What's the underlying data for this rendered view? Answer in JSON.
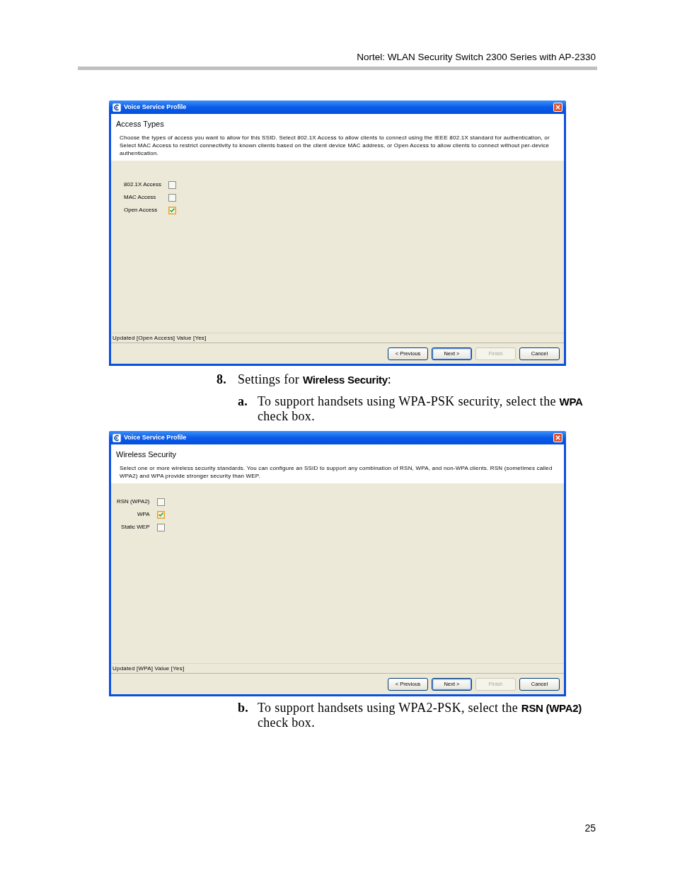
{
  "page_header": {
    "title": "Nortel: WLAN Security Switch 2300 Series with AP-2330"
  },
  "blocks": [
    {
      "kind": "dialog",
      "window_title": "Voice Service Profile",
      "heading": "Access Types",
      "description": "Choose the types of access you want to allow for this SSID. Select 802.1X Access to allow clients to connect using the IEEE 802.1X standard for authentication, or Select MAC Access to restrict connectivity to known clients based on the client device MAC address, or Open Access to allow clients to connect without per-device authentication.",
      "labels_right_aligned": false,
      "options": [
        {
          "label": "802.1X Access",
          "checked": false,
          "highlighted": false
        },
        {
          "label": "MAC Access",
          "checked": false,
          "highlighted": false
        },
        {
          "label": "Open Access",
          "checked": true,
          "highlighted": true
        }
      ],
      "status_text": "Updated [Open Access] Value [Yes]",
      "buttons": [
        {
          "label": "< Previous",
          "disabled": false,
          "default": false
        },
        {
          "label": "Next >",
          "disabled": false,
          "default": true
        },
        {
          "label": "Finish",
          "disabled": true,
          "default": false
        },
        {
          "label": "Cancel",
          "disabled": false,
          "default": false
        }
      ]
    },
    {
      "kind": "step",
      "number": "8.",
      "text": "Settings for **Wireless Security**:"
    },
    {
      "kind": "substep",
      "number": "a.",
      "text": "To support handsets using WPA-PSK security, select the **WPA** check box."
    },
    {
      "kind": "dialog",
      "window_title": "Voice Service Profile",
      "heading": "Wireless Security",
      "description": "Select one or more wireless security standards. You can configure an SSID to support any combination of RSN, WPA, and non-WPA clients. RSN (sometimes called WPA2) and WPA provide stronger security than WEP.",
      "labels_right_aligned": true,
      "options": [
        {
          "label": "RSN (WPA2)",
          "checked": false,
          "highlighted": false
        },
        {
          "label": "WPA",
          "checked": true,
          "highlighted": true
        },
        {
          "label": "Static WEP",
          "checked": false,
          "highlighted": false
        }
      ],
      "status_text": "Updated [WPA] Value [Yes]",
      "buttons": [
        {
          "label": "< Previous",
          "disabled": false,
          "default": false
        },
        {
          "label": "Next >",
          "disabled": false,
          "default": true
        },
        {
          "label": "Finish",
          "disabled": true,
          "default": false
        },
        {
          "label": "Cancel",
          "disabled": false,
          "default": false
        }
      ]
    },
    {
      "kind": "substep",
      "number": "b.",
      "text": "To support handsets using WPA2-PSK, select the **RSN (WPA2)** check box."
    }
  ],
  "page_number": "25"
}
